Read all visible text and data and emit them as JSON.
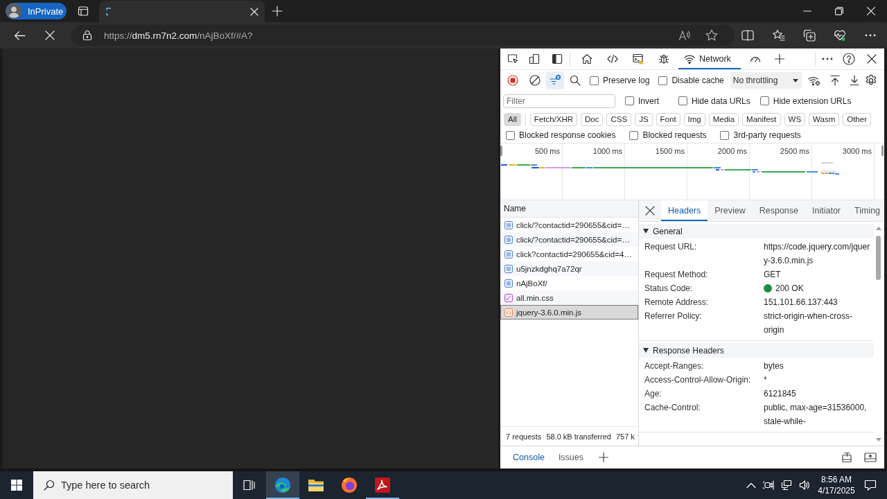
{
  "browser": {
    "profile": {
      "label": "InPrivate"
    },
    "tabs": [
      {
        "selected": true,
        "loading": true
      }
    ],
    "address": {
      "scheme": "https://",
      "host": "dm5.rn7n2.com",
      "path": "/nAjBoXf/#A?"
    }
  },
  "devtools": {
    "tool_tabs": [
      {
        "kind": "welcome",
        "selected": false
      },
      {
        "kind": "elements",
        "selected": false
      },
      {
        "kind": "console",
        "selected": false
      },
      {
        "kind": "sources",
        "selected": false
      },
      {
        "kind": "network",
        "label": "Network",
        "selected": true
      },
      {
        "kind": "performance",
        "selected": false
      }
    ],
    "toolbar": {
      "recording": true,
      "filter_open": true,
      "checkboxes": [
        {
          "label": "Preserve log",
          "checked": false
        },
        {
          "label": "Disable cache",
          "checked": false
        }
      ],
      "throttling": "No throttling"
    },
    "filter": {
      "placeholder": "Filter",
      "checkboxes": [
        {
          "label": "Invert",
          "checked": false
        },
        {
          "label": "Hide data URLs",
          "checked": false
        },
        {
          "label": "Hide extension URLs",
          "checked": false
        }
      ],
      "types": [
        {
          "label": "All",
          "selected": true
        },
        {
          "label": "Fetch/XHR",
          "selected": false
        },
        {
          "label": "Doc",
          "selected": false
        },
        {
          "label": "CSS",
          "selected": false
        },
        {
          "label": "JS",
          "selected": false
        },
        {
          "label": "Font",
          "selected": false
        },
        {
          "label": "Img",
          "selected": false
        },
        {
          "label": "Media",
          "selected": false
        },
        {
          "label": "Manifest",
          "selected": false
        },
        {
          "label": "WS",
          "selected": false
        },
        {
          "label": "Wasm",
          "selected": false
        },
        {
          "label": "Other",
          "selected": false
        }
      ],
      "more_checkboxes": [
        {
          "label": "Blocked response cookies",
          "checked": false
        },
        {
          "label": "Blocked requests",
          "checked": false
        },
        {
          "label": "3rd-party requests",
          "checked": false
        }
      ]
    },
    "overview": {
      "ticks": [
        "500 ms",
        "1000 ms",
        "1500 ms",
        "2000 ms",
        "2500 ms",
        "3000 ms"
      ]
    },
    "requests": {
      "column": "Name",
      "rows": [
        {
          "name": "click/?contactid=290655&cid=…",
          "kind": "document",
          "selected": false
        },
        {
          "name": "click/?contactid=290655&cid=…",
          "kind": "document",
          "selected": false
        },
        {
          "name": "click?contactid=290655&cid=4…",
          "kind": "document",
          "selected": false
        },
        {
          "name": "u5jnzkdghq7a72qr",
          "kind": "document",
          "selected": false
        },
        {
          "name": "nAjBoXf/",
          "kind": "document",
          "selected": false
        },
        {
          "name": "all.min.css",
          "kind": "stylesheet",
          "selected": false
        },
        {
          "name": "jquery-3.6.0.min.js",
          "kind": "script",
          "selected": true
        }
      ],
      "summary": [
        "7 requests",
        "58.0 kB transferred",
        "757 k"
      ]
    },
    "details": {
      "tabs": [
        {
          "label": "Headers",
          "selected": true
        },
        {
          "label": "Preview",
          "selected": false
        },
        {
          "label": "Response",
          "selected": false
        },
        {
          "label": "Initiator",
          "selected": false
        },
        {
          "label": "Timing",
          "selected": false
        }
      ],
      "sections": [
        {
          "title": "General",
          "expanded": true,
          "rows": [
            {
              "name": "Request URL:",
              "value": "https://code.jquery.com/jquery-3.6.0.min.js"
            },
            {
              "name": "Request Method:",
              "value": "GET"
            },
            {
              "name": "Status Code:",
              "value": "200 OK",
              "color": "#1e8e3e"
            },
            {
              "name": "Remote Address:",
              "value": "151.101.66.137:443"
            },
            {
              "name": "Referrer Policy:",
              "value": "strict-origin-when-cross-origin"
            }
          ]
        },
        {
          "title": "Response Headers",
          "expanded": true,
          "rows": [
            {
              "name": "Accept-Ranges:",
              "value": "bytes"
            },
            {
              "name": "Access-Control-Allow-Origin:",
              "value": "*"
            },
            {
              "name": "Age:",
              "value": "6121845"
            },
            {
              "name": "Cache-Control:",
              "value": "public, max-age=31536000, stale-while-"
            }
          ]
        }
      ]
    },
    "drawer": {
      "tabs": [
        {
          "label": "Console",
          "selected": true
        },
        {
          "label": "Issues",
          "selected": false
        }
      ]
    }
  },
  "taskbar": {
    "search": {
      "placeholder": "Type here to search"
    },
    "apps": [
      {
        "kind": "edge",
        "selected": true,
        "running": true
      },
      {
        "kind": "explorer",
        "selected": false,
        "running": false
      },
      {
        "kind": "firefox",
        "selected": false,
        "running": false
      },
      {
        "kind": "acrobat",
        "selected": false,
        "running": true
      }
    ],
    "time": "8:56 AM",
    "date": "4/17/2025"
  }
}
